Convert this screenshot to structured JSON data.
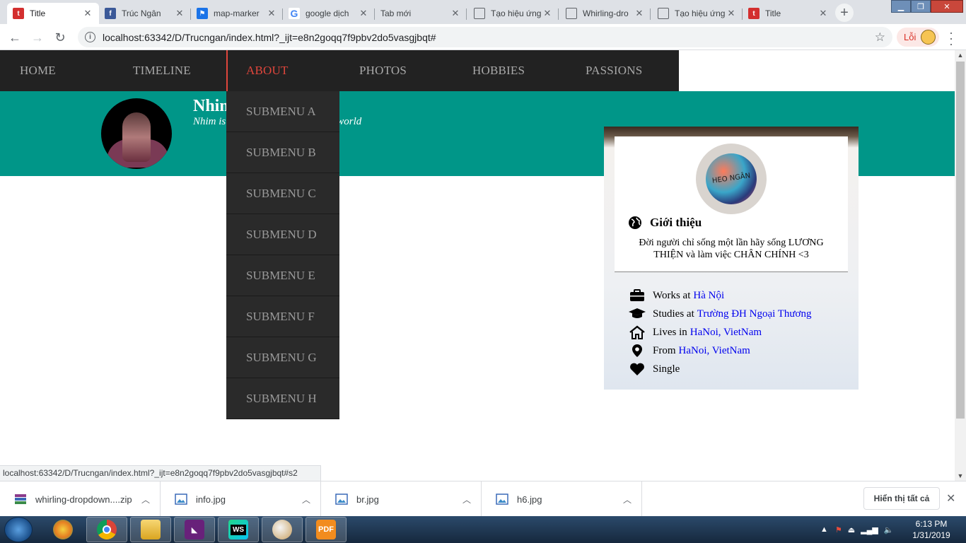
{
  "browser": {
    "tabs": [
      {
        "title": "Title",
        "favicon": "t-favicon",
        "active": true
      },
      {
        "title": "Trúc Ngân",
        "favicon": "facebook-icon",
        "active": false
      },
      {
        "title": "map-marker",
        "favicon": "map-favicon",
        "active": false
      },
      {
        "title": "google dịch",
        "favicon": "google-icon",
        "active": false
      },
      {
        "title": "Tab mới",
        "favicon": "none",
        "active": false
      },
      {
        "title": "Tạo hiệu ứng",
        "favicon": "document-icon",
        "active": false
      },
      {
        "title": "Whirling-dro",
        "favicon": "document-icon",
        "active": false
      },
      {
        "title": "Tạo hiệu ứng",
        "favicon": "document-icon",
        "active": false
      },
      {
        "title": "Title",
        "favicon": "t-favicon",
        "active": false
      }
    ],
    "new_tab_label": "+",
    "url": "localhost:63342/D/Trucngan/index.html?_ijt=e8n2goqq7f9pbv2do5vasgjbqt#",
    "error_badge": "Lỗi",
    "status_url": "localhost:63342/D/Trucngan/index.html?_ijt=e8n2goqq7f9pbv2do5vasgjbqt#s2"
  },
  "site": {
    "nav": [
      "HOME",
      "TIMELINE",
      "ABOUT",
      "PHOTOS",
      "HOBBIES",
      "PASSIONS"
    ],
    "active_nav": "ABOUT",
    "submenu": [
      "SUBMENU A",
      "SUBMENU B",
      "SUBMENU C",
      "SUBMENU D",
      "SUBMENU E",
      "SUBMENU F",
      "SUBMENU G",
      "SUBMENU H"
    ],
    "name": "Nhim",
    "tagline_start": "Nhim is",
    "tagline_end": "world",
    "accent_color": "#009688",
    "active_color": "#e0463c"
  },
  "card": {
    "avatar_text": "HEO NGÂN",
    "intro_title": "Giới thiệu",
    "intro_text": "Đời người chỉ sống một lần hãy sống LƯƠNG THIỆN và làm việc CHÂN CHÍNH <3",
    "facts": [
      {
        "icon": "briefcase-icon",
        "label": "Works at",
        "link": "Hà Nội"
      },
      {
        "icon": "graduation-cap-icon",
        "label": "Studies at",
        "link": "Trường ĐH Ngoại Thương"
      },
      {
        "icon": "home-icon",
        "label": "Lives in",
        "link": "HaNoi, VietNam"
      },
      {
        "icon": "map-marker-icon",
        "label": "From",
        "link": "HaNoi, VietNam"
      },
      {
        "icon": "heart-icon",
        "label": "Single",
        "link": ""
      }
    ]
  },
  "downloads": {
    "items": [
      "whirling-dropdown....zip",
      "info.jpg",
      "br.jpg",
      "h6.jpg"
    ],
    "show_all": "Hiển thị tất cả"
  },
  "taskbar": {
    "apps": [
      "windows-explorer-icon",
      "chrome-icon",
      "file-explorer-icon",
      "visual-studio-icon",
      "webstorm-icon",
      "paint-icon",
      "foxit-pdf-icon"
    ],
    "time": "6:13 PM",
    "date": "1/31/2019"
  }
}
